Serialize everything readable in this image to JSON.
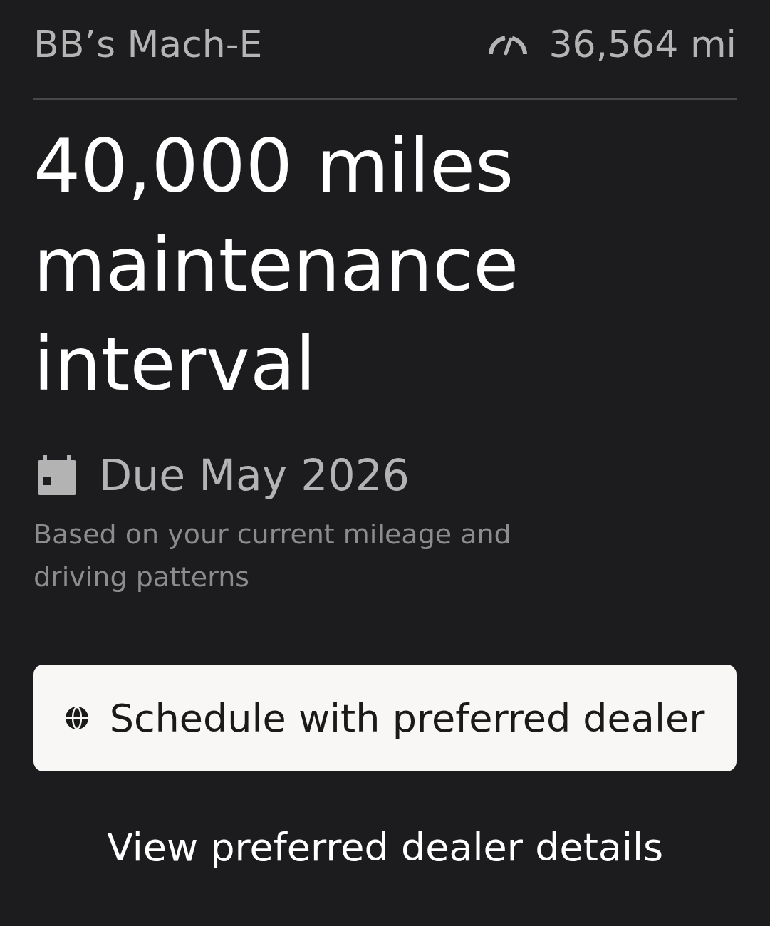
{
  "header": {
    "vehicle_name": "BB’s Mach-E",
    "odometer": "36,564 mi"
  },
  "maintenance": {
    "title": "40,000 miles maintenance interval",
    "due": "Due May 2026",
    "note": "Based on your current mileage and driving patterns"
  },
  "actions": [
    {
      "kind": "primary",
      "label": "Schedule with preferred dealer"
    },
    {
      "kind": "link",
      "label": "View preferred dealer details"
    }
  ]
}
